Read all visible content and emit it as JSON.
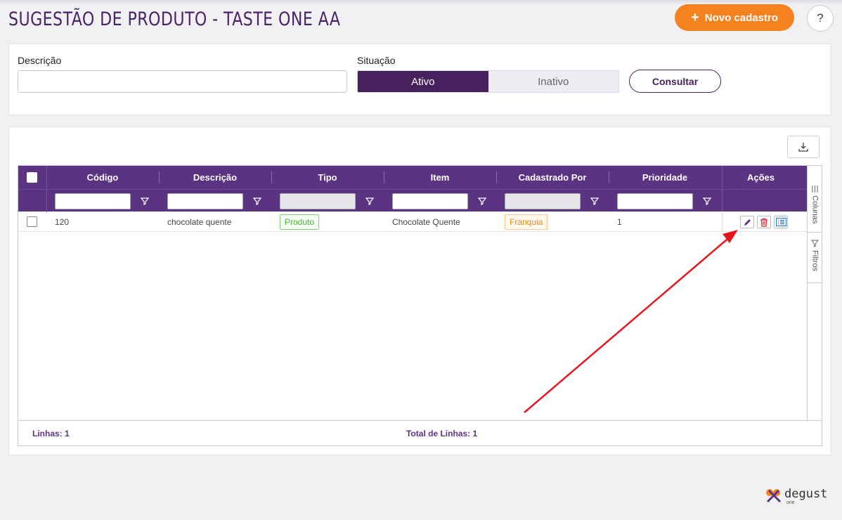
{
  "header": {
    "title": "SUGESTÃO DE PRODUTO - TASTE ONE AA",
    "new_button_label": "Novo cadastro",
    "help_label": "?"
  },
  "filters": {
    "description_label": "Descrição",
    "description_value": "",
    "status_label": "Situação",
    "status_options": [
      "Ativo",
      "Inativo"
    ],
    "status_selected": "Ativo",
    "consult_label": "Consultar"
  },
  "grid": {
    "columns": [
      "Código",
      "Descrição",
      "Tipo",
      "Item",
      "Cadastrado Por",
      "Prioridade",
      "Ações"
    ],
    "rows": [
      {
        "codigo": "120",
        "descricao": "chocolate quente",
        "tipo": "Produto",
        "item": "Chocolate Quente",
        "cadastrado_por": "Franquia",
        "prioridade": "1"
      }
    ],
    "side_tabs": [
      "Colunas",
      "Filtros"
    ],
    "footer": {
      "lines": "Linhas: 1",
      "total_lines": "Total de Linhas: 1"
    }
  },
  "brand": {
    "name": "degust",
    "sub": "one"
  },
  "colors": {
    "primary": "#5b3383",
    "primary_dark": "#47205e",
    "accent": "#f5821f",
    "annotation_arrow": "#e8141b"
  },
  "icons": [
    "plus-icon",
    "help-icon",
    "download-icon",
    "filter-icon",
    "edit-icon",
    "trash-icon",
    "details-icon",
    "columns-icon",
    "filters-icon",
    "degust-logo"
  ]
}
